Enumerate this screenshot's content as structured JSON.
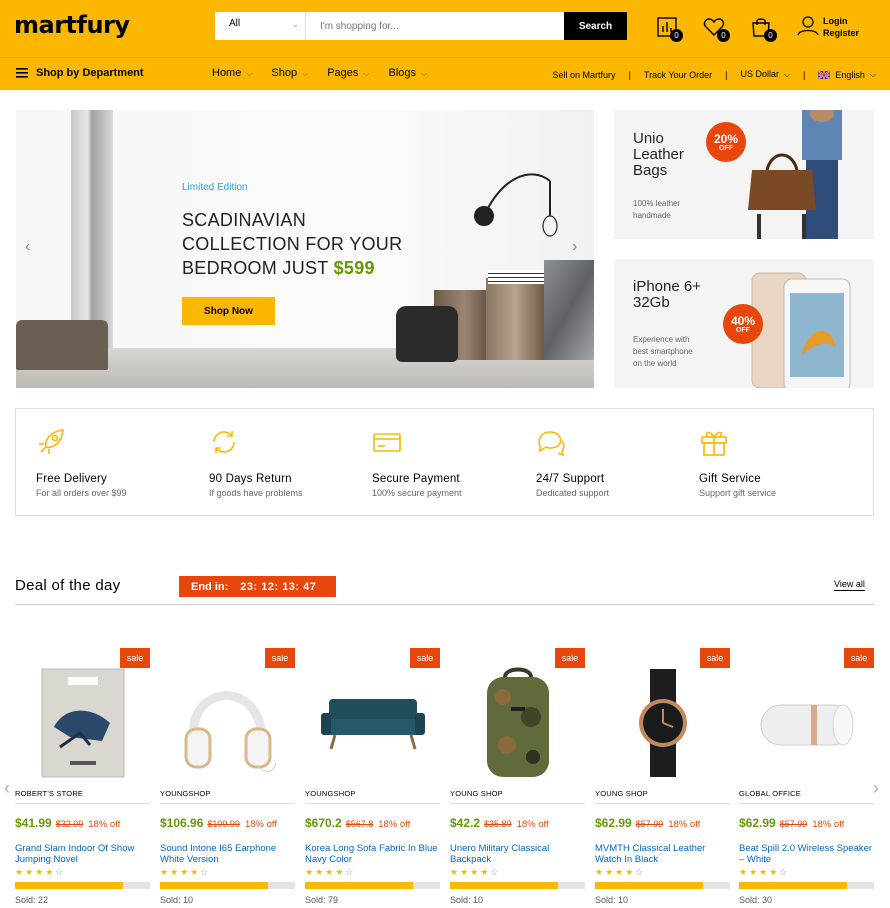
{
  "header": {
    "logo": "martfury",
    "search": {
      "category": "All",
      "placeholder": "I'm shopping for...",
      "button": "Search"
    },
    "compare_count": "0",
    "wishlist_count": "0",
    "cart_count": "0",
    "login": "Login",
    "register": "Register"
  },
  "nav": {
    "department": "Shop by Department",
    "menu": [
      "Home",
      "Shop",
      "Pages",
      "Blogs"
    ],
    "sell": "Sell on Martfury",
    "track": "Track Your Order",
    "currency": "US Dollar",
    "language": "English"
  },
  "hero": {
    "label": "Limited Edition",
    "line1": "SCADINAVIAN",
    "line2": "COLLECTION FOR YOUR",
    "line3": "BEDROOM JUST",
    "price": "$599",
    "button": "Shop Now"
  },
  "promos": [
    {
      "title1": "Unio",
      "title2": "Leather",
      "title3": "Bags",
      "sub1": "100% leather",
      "sub2": "handmade",
      "discount": "20%",
      "off": "OFF"
    },
    {
      "title1": "iPhone 6+",
      "title2": "32Gb",
      "sub1": "Experience with",
      "sub2": "best smartphone",
      "sub3": "on the world",
      "discount": "40%",
      "off": "OFF"
    }
  ],
  "features": [
    {
      "title": "Free Delivery",
      "sub": "For all orders over $99",
      "icon": "rocket-icon"
    },
    {
      "title": "90 Days Return",
      "sub": "If goods have problems",
      "icon": "sync-icon"
    },
    {
      "title": "Secure Payment",
      "sub": "100% secure payment",
      "icon": "credit-card-icon"
    },
    {
      "title": "24/7 Support",
      "sub": "Dedicated support",
      "icon": "bubbles-icon"
    },
    {
      "title": "Gift Service",
      "sub": "Support gift service",
      "icon": "gift-icon"
    }
  ],
  "deal": {
    "title": "Deal of the day",
    "end_label": "End in:",
    "countdown": "23: 12: 13: 47",
    "view_all": "View all",
    "sale_label": "sale",
    "products": [
      {
        "store": "ROBERT'S STORE",
        "price": "$41.99",
        "old": "$32.99",
        "off": "18% off",
        "name": "Grand Slam Indoor Of Show Jumping Novel",
        "rating": 4,
        "sold_fraction": 0.8,
        "sold": "Sold: 22"
      },
      {
        "store": "YOUNGSHOP",
        "price": "$106.96",
        "old": "$109.99",
        "off": "18% off",
        "name": "Sound Intone I65 Earphone White Version",
        "rating": 4,
        "sold_fraction": 0.8,
        "sold": "Sold: 10"
      },
      {
        "store": "YOUNGSHOP",
        "price": "$670.2",
        "old": "$567.8",
        "off": "18% off",
        "name": "Korea Long Sofa Fabric In Blue Navy Color",
        "rating": 4,
        "sold_fraction": 0.8,
        "sold": "Sold: 79"
      },
      {
        "store": "YOUNG SHOP",
        "price": "$42.2",
        "old": "$35.89",
        "off": "18% off",
        "name": "Unero Military Classical Backpack",
        "rating": 4,
        "sold_fraction": 0.8,
        "sold": "Sold: 10"
      },
      {
        "store": "YOUNG SHOP",
        "price": "$62.99",
        "old": "$57.99",
        "off": "18% off",
        "name": "MVMTH Classical Leather Watch In Black",
        "rating": 4,
        "sold_fraction": 0.8,
        "sold": "Sold: 10"
      },
      {
        "store": "GLOBAL OFFICE",
        "price": "$62.99",
        "old": "$57.99",
        "off": "18% off",
        "name": "Beat Spill 2.0 Wireless Speaker – White",
        "rating": 4,
        "sold_fraction": 0.8,
        "sold": "Sold: 30"
      }
    ]
  },
  "colors": {
    "brand": "#fcb800",
    "sale": "#e8470b",
    "price": "#669900",
    "link": "#0066cc"
  }
}
